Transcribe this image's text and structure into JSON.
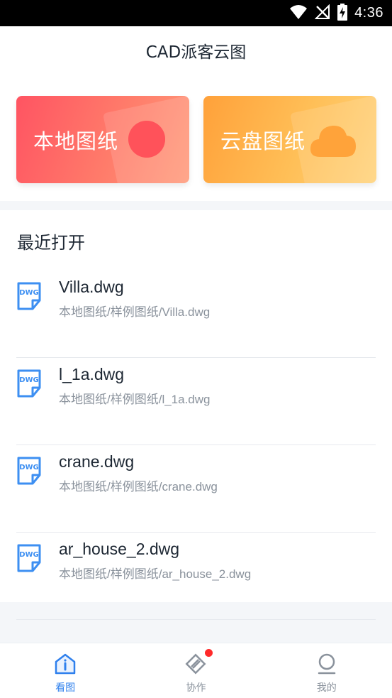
{
  "status_bar": {
    "time": "4:36",
    "icons": [
      "wifi-icon",
      "signal-off-icon",
      "battery-charging-icon"
    ]
  },
  "header": {
    "title": "CAD派客云图"
  },
  "cards": {
    "local": {
      "label": "本地图纸",
      "icon": "record-circle-icon",
      "color": "#ff5a5f"
    },
    "cloud": {
      "label": "云盘图纸",
      "icon": "cloud-icon",
      "color": "#ffaa3c"
    }
  },
  "recent": {
    "title": "最近打开",
    "files": [
      {
        "name": "Villa.dwg",
        "path": "本地图纸/样例图纸/Villa.dwg",
        "icon": "dwg-file-icon"
      },
      {
        "name": "l_1a.dwg",
        "path": "本地图纸/样例图纸/l_1a.dwg",
        "icon": "dwg-file-icon"
      },
      {
        "name": "crane.dwg",
        "path": "本地图纸/样例图纸/crane.dwg",
        "icon": "dwg-file-icon"
      },
      {
        "name": "ar_house_2.dwg",
        "path": "本地图纸/样例图纸/ar_house_2.dwg",
        "icon": "dwg-file-icon"
      }
    ]
  },
  "bottom_nav": {
    "items": [
      {
        "label": "看图",
        "icon": "home-view-icon",
        "active": true
      },
      {
        "label": "协作",
        "icon": "collaborate-icon",
        "active": false,
        "badge": true
      },
      {
        "label": "我的",
        "icon": "profile-icon",
        "active": false
      }
    ]
  },
  "colors": {
    "accent": "#2f80ed",
    "badge": "#ff2a2a",
    "dwg_icon": "#3d8ff2"
  }
}
